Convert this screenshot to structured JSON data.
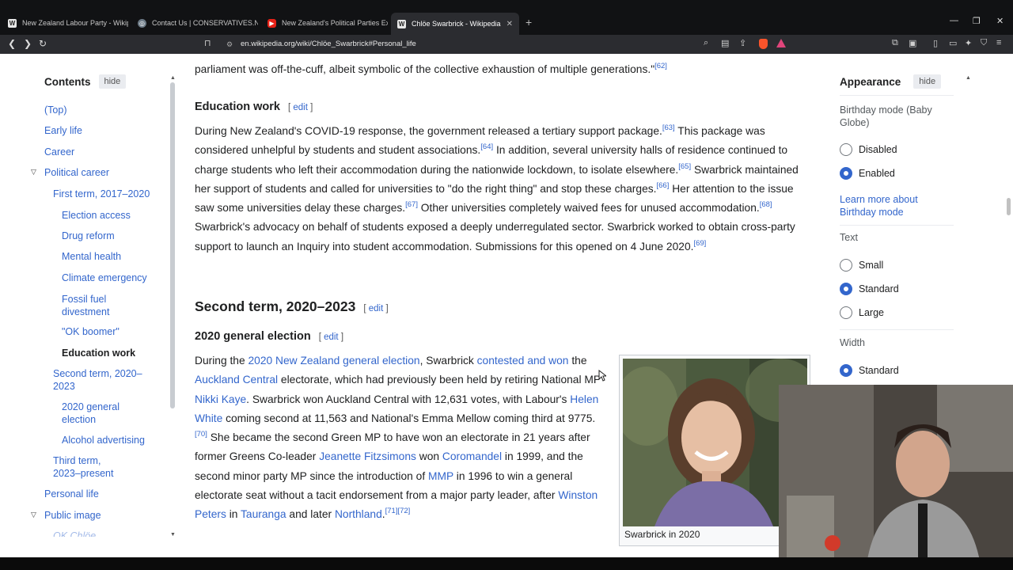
{
  "browser": {
    "tabs": [
      {
        "label": "New Zealand Labour Party - Wikiped",
        "favicon": "W"
      },
      {
        "label": "Contact Us | CONSERVATIVES.NZ",
        "favicon": "C"
      },
      {
        "label": "New Zealand's Political Parties Explai",
        "favicon": "yt"
      },
      {
        "label": "Chlöe Swarbrick - Wikipedia",
        "favicon": "W",
        "active": true
      }
    ],
    "url": "en.wikipedia.org/wiki/Chlöe_Swarbrick#Personal_life"
  },
  "toc": {
    "title": "Contents",
    "hide_label": "hide",
    "items": [
      {
        "label": "(Top)"
      },
      {
        "label": "Early life"
      },
      {
        "label": "Career"
      },
      {
        "label": "Political career"
      },
      {
        "label": "First term, 2017–2020"
      },
      {
        "label": "Election access"
      },
      {
        "label": "Drug reform"
      },
      {
        "label": "Mental health"
      },
      {
        "label": "Climate emergency"
      },
      {
        "label": "Fossil fuel divestment"
      },
      {
        "label": "\"OK boomer\""
      },
      {
        "label": "Education work"
      },
      {
        "label": "Second term, 2020–2023"
      },
      {
        "label": "2020 general election"
      },
      {
        "label": "Alcohol advertising"
      },
      {
        "label": "Third term, 2023–present"
      },
      {
        "label": "Personal life"
      },
      {
        "label": "Public image"
      },
      {
        "label": "OK Chlöe"
      }
    ]
  },
  "article": {
    "top_line": "parliament was off-the-cuff, albeit symbolic of the collective exhaustion of multiple generations.\"",
    "top_ref": "[62]",
    "edit_label": "edit",
    "education_heading": "Education work",
    "edu": {
      "p1": "During New Zealand's COVID-19 response, the government released a tertiary support package.",
      "r63": "[63]",
      "p2": " This package was considered unhelpful by students and student associations.",
      "r64": "[64]",
      "p3": " In addition, several university halls of residence continued to charge students who left their accommodation during the nationwide lockdown, to isolate elsewhere.",
      "r65": "[65]",
      "p4": " Swarbrick maintained her support of students and called for universities to \"do the right thing\" and stop these charges.",
      "r66": "[66]",
      "p5": " Her attention to the issue saw some universities delay these charges.",
      "r67": "[67]",
      "p6": " Other universities completely waived fees for unused accommodation.",
      "r68": "[68]",
      "p7": " Swarbrick's advocacy on behalf of students exposed a deeply underregulated sector. Swarbrick worked to obtain cross-party support to launch an Inquiry into student accommodation. Submissions for this opened on 4 June 2020.",
      "r69": "[69]"
    },
    "second_term_heading": "Second term, 2020–2023",
    "election_heading": "2020 general election",
    "elec": {
      "t1": "During the ",
      "l1": "2020 New Zealand general election",
      "t2": ", Swarbrick ",
      "l2": "contested and won",
      "t3": " the ",
      "l3": "Auckland Central",
      "t4": " electorate, which had previously been held by retiring National MP ",
      "l4": "Nikki Kaye",
      "t5": ". Swarbrick won Auckland Central with 12,631 votes, with Labour's ",
      "l5": "Helen White",
      "t6": " coming second at 11,563 and National's Emma Mellow coming third at 9775.",
      "r70": "[70]",
      "t7": " She became the second Green MP to have won an electorate in 21 years after former Greens Co-leader ",
      "l6": "Jeanette Fitzsimons",
      "t8": " won ",
      "l7": "Coromandel",
      "t9": " in 1999, and the second minor party MP since the introduction of ",
      "l8": "MMP",
      "t10": " in 1996 to win a general electorate seat without a tacit endorsement from a major party leader, after ",
      "l9": "Winston Peters",
      "t11": " in ",
      "l10": "Tauranga",
      "t12": " and later ",
      "l11": "Northland",
      "t13": ".",
      "r71": "[71]",
      "r72": "[72]"
    },
    "figure_caption": "Swarbrick in 2020"
  },
  "appearance": {
    "title": "Appearance",
    "hide_label": "hide",
    "birthday_label": "Birthday mode (Baby Globe)",
    "birthday_options": [
      "Disabled",
      "Enabled"
    ],
    "birthday_selected": "Enabled",
    "learn_more": "Learn more about Birthday mode",
    "text_label": "Text",
    "text_options": [
      "Small",
      "Standard",
      "Large"
    ],
    "text_selected": "Standard",
    "width_label": "Width",
    "width_options": [
      "Standard"
    ],
    "width_selected": "Standard"
  },
  "colors": {
    "link": "#3366cc",
    "radio_on": "#3366cc",
    "tab_bar": "#111214",
    "toolbar": "#2b2c30"
  }
}
